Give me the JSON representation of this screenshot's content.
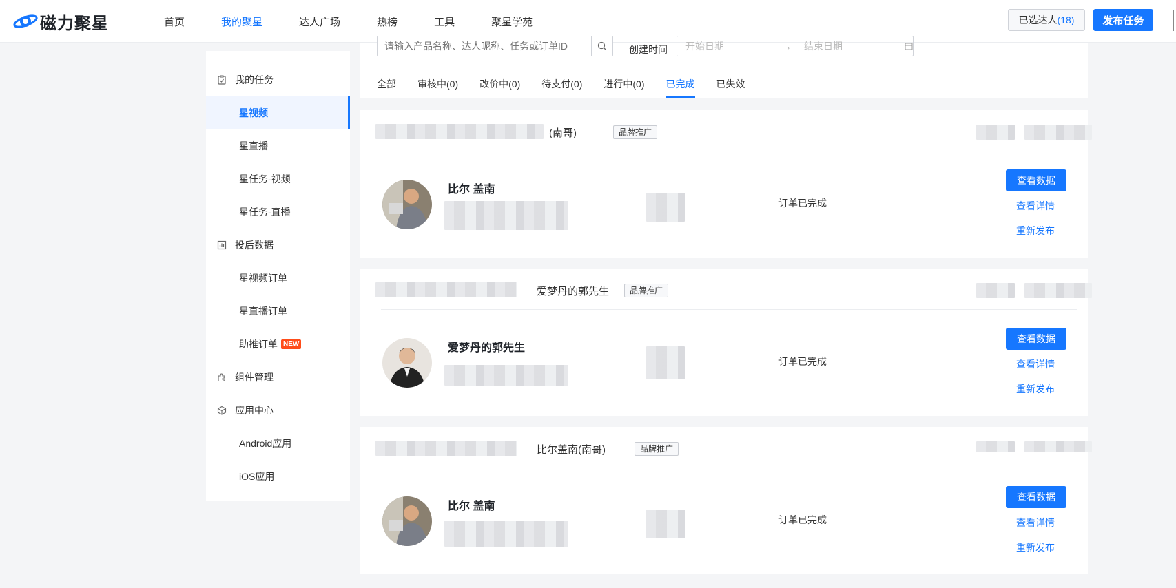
{
  "brand": {
    "name": "磁力聚星"
  },
  "nav": {
    "items": [
      {
        "label": "首页",
        "active": false
      },
      {
        "label": "我的聚星",
        "active": true
      },
      {
        "label": "达人广场",
        "active": false
      },
      {
        "label": "热榜",
        "active": false
      },
      {
        "label": "工具",
        "active": false
      },
      {
        "label": "聚星学苑",
        "active": false
      }
    ],
    "selected_label": "已选达人",
    "selected_count": "(18)",
    "publish_label": "发布任务"
  },
  "sidebar": {
    "groups": [
      {
        "label": "我的任务",
        "icon": "clipboard-check-icon"
      },
      {
        "label": "投后数据",
        "icon": "bar-chart-icon"
      },
      {
        "label": "组件管理",
        "icon": "puzzle-icon"
      },
      {
        "label": "应用中心",
        "icon": "cube-icon"
      }
    ],
    "items": [
      {
        "label": "星视频",
        "active": true
      },
      {
        "label": "星直播"
      },
      {
        "label": "星任务-视频"
      },
      {
        "label": "星任务-直播"
      },
      {
        "label": "星视频订单"
      },
      {
        "label": "星直播订单"
      },
      {
        "label": "助推订单",
        "badge": "NEW"
      },
      {
        "label": "Android应用"
      },
      {
        "label": "iOS应用"
      }
    ]
  },
  "filter": {
    "search_placeholder": "请输入产品名称、达人昵称、任务或订单ID",
    "date_label": "创建时间",
    "start_placeholder": "开始日期",
    "end_placeholder": "结束日期",
    "tabs": [
      {
        "label": "全部"
      },
      {
        "label": "审核中(0)"
      },
      {
        "label": "改价中(0)"
      },
      {
        "label": "待支付(0)"
      },
      {
        "label": "进行中(0)"
      },
      {
        "label": "已完成",
        "active": true
      },
      {
        "label": "已失效"
      }
    ]
  },
  "orders": [
    {
      "head_name": "(南哥)",
      "tag": "品牌推广",
      "creator": "比尔 盖南",
      "status": "订单已完成",
      "view_data": "查看数据",
      "view_detail": "查看详情",
      "republish": "重新发布"
    },
    {
      "head_name": "爱梦丹的郭先生",
      "tag": "品牌推广",
      "creator": "爱梦丹的郭先生",
      "status": "订单已完成",
      "view_data": "查看数据",
      "view_detail": "查看详情",
      "republish": "重新发布"
    },
    {
      "head_name": "比尔盖南(南哥)",
      "tag": "品牌推广",
      "creator": "比尔 盖南",
      "status": "订单已完成",
      "view_data": "查看数据",
      "view_detail": "查看详情",
      "republish": "重新发布"
    }
  ],
  "colors": {
    "accent": "#1677ff",
    "badge": "#ff4d1a"
  }
}
